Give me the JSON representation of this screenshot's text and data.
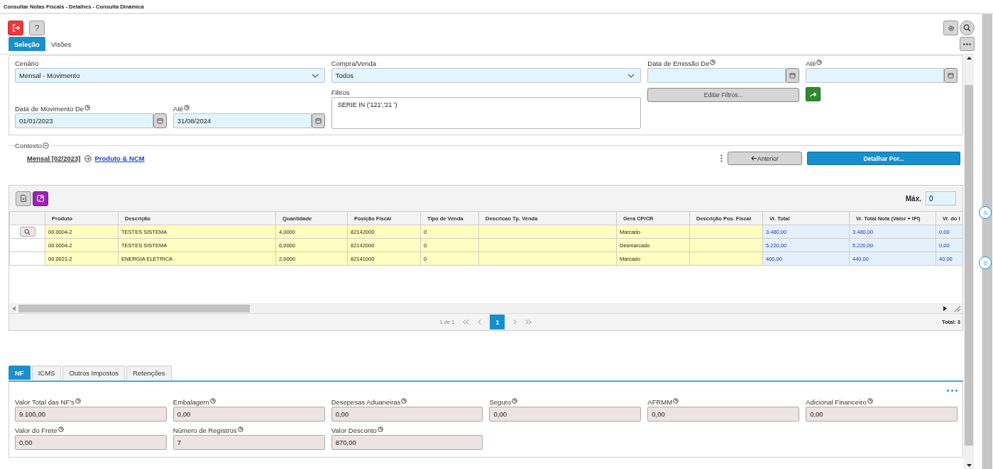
{
  "window": {
    "title": "Consultar Notas Fiscais - Detalhes - Consulta Dinâmica"
  },
  "toolbar": {
    "help_label": "?"
  },
  "tabs": [
    {
      "label": "Seleção",
      "selected": true
    },
    {
      "label": "Visões",
      "selected": false
    }
  ],
  "form": {
    "fields": [
      {
        "label": "Cenário",
        "value": "Mensal - Movimento",
        "kind": "select",
        "info": false
      },
      {
        "label": "Compra/Venda",
        "value": "Todos",
        "kind": "select",
        "info": false
      },
      {
        "label": "Data de Emissão De",
        "kind": "date",
        "info": true
      },
      {
        "label": "Até",
        "kind": "date",
        "info": true
      }
    ],
    "movement_fields": [
      {
        "label": "Data de Movimento De",
        "value": "01/01/2023",
        "kind": "date",
        "info": true
      },
      {
        "label": "Até",
        "value": "31/08/2024",
        "kind": "date",
        "info": true
      }
    ],
    "filters": {
      "label": "Filtros",
      "value": "SERIE IN ('121','21 ')"
    },
    "edit_filters_button": "Editar Filtros..."
  },
  "context": {
    "legend": "Contexto",
    "path": "Mensal [02/2023]",
    "link": "Produto & NCM",
    "previous_button": "Anterior",
    "detail_button": "Detalhar Por..."
  },
  "grid": {
    "max_label": "Máx.",
    "max_value": "0",
    "columns": [
      {
        "label": "Produto",
        "kind": "text"
      },
      {
        "label": "Descrição",
        "kind": "text"
      },
      {
        "label": "Quantidade",
        "kind": "text"
      },
      {
        "label": "Posição Fiscal",
        "kind": "text"
      },
      {
        "label": "Tipo de Venda",
        "kind": "text"
      },
      {
        "label": "Descricao Tp. Venda",
        "kind": "text"
      },
      {
        "label": "Gera CP/CR",
        "kind": "text"
      },
      {
        "label": "Descrição Pos. Fiscal",
        "kind": "text"
      },
      {
        "label": "Vr. Total",
        "kind": "value"
      },
      {
        "label": "Vr. Total Nota (Valor + IPI)",
        "kind": "value"
      },
      {
        "label": "Vr. do I",
        "kind": "value"
      }
    ],
    "rows": [
      {
        "has_search": true,
        "cells": [
          "00.0004-2",
          "TESTES SISTEMA",
          "4,0000",
          "82142000",
          "0",
          "",
          "Marcado",
          "",
          "3.480,00",
          "3.480,00",
          "0,00"
        ]
      },
      {
        "has_search": false,
        "cells": [
          "00.0004-2",
          "TESTES SISTEMA",
          "6,0000",
          "82142000",
          "0",
          "",
          "Desmarcado",
          "",
          "5.220,00",
          "5.220,00",
          "0,00"
        ]
      },
      {
        "has_search": false,
        "cells": [
          "00.0021-2",
          "ENERGIA ELETRICA",
          "2,0000",
          "82141000",
          "0",
          "",
          "Marcado",
          "",
          "400,00",
          "440,00",
          "40,00"
        ]
      }
    ],
    "pager": {
      "range": "1 de 1",
      "pages": [
        {
          "label": "1",
          "selected": true
        }
      ],
      "total": "Total: 3"
    }
  },
  "summary_tabs": [
    {
      "label": "NF",
      "selected": true
    },
    {
      "label": "ICMS",
      "selected": false
    },
    {
      "label": "Outros Impostos",
      "selected": false
    },
    {
      "label": "Retenções",
      "selected": false
    }
  ],
  "summary": {
    "fields": [
      {
        "label": "Valor Total das NF's",
        "value": "9.100,00"
      },
      {
        "label": "Embalagem",
        "value": "0,00"
      },
      {
        "label": "Desepesas Aduaneiras",
        "value": "0,00"
      },
      {
        "label": "Seguro",
        "value": "0,00"
      },
      {
        "label": "AFRMM",
        "value": "0,00"
      },
      {
        "label": "Adicional Financeiro",
        "value": "0,00"
      },
      {
        "label": "Valor do Frete",
        "value": "0,00"
      },
      {
        "label": "Número de Registros",
        "value": "7"
      },
      {
        "label": "Valor Desconto",
        "value": "870,00"
      }
    ]
  }
}
